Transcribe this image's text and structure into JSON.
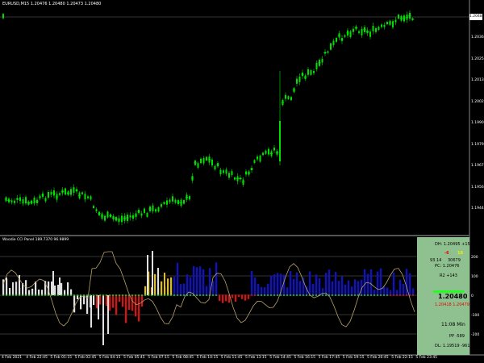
{
  "header": {
    "symbol_line": "EURUSD,M15  1.20476 1.20480 1.20473 1.20480"
  },
  "price_axis": {
    "current_price": "1.20480",
    "ticks": [
      "1.20480",
      "1.20365",
      "1.20250",
      "1.20135",
      "1.20020",
      "1.19905",
      "1.19790",
      "1.19675",
      "1.19560",
      "1.19445"
    ]
  },
  "time_axis": {
    "ticks": [
      "4 Feb 2021",
      "4 Feb 22:45",
      "5 Feb 01:15",
      "5 Feb 02:45",
      "5 Feb 04:15",
      "5 Feb 05:45",
      "5 Feb 07:15",
      "5 Feb 08:45",
      "5 Feb 10:15",
      "5 Feb 11:45",
      "5 Feb 13:15",
      "5 Feb 14:45",
      "5 Feb 16:15",
      "5 Feb 17:45",
      "5 Feb 19:15",
      "5 Feb 20:45",
      "5 Feb 22:15",
      "5 Feb 23:45"
    ]
  },
  "indicator": {
    "title": "Woodie CCI Panel 189.7370 96.9899",
    "levels": [
      "200",
      "100",
      "0",
      "-100",
      "-200"
    ]
  },
  "panel": {
    "dh": "DH: 1.20495  +15",
    "dn_val": "-6",
    "up_val": "18",
    "rsi": "93.14",
    "rsi2": "30679",
    "pc": "PC: 1.20476",
    "r2": "R2 +143",
    "price": "1.20480",
    "sub_price": "1.20418  1.20479",
    "time": "11:08 Min",
    "pp": "PP -589",
    "dl": "DL: 1.19519 -961"
  },
  "colors": {
    "candle": "#00e000",
    "hist_blue": "#1010d0",
    "hist_red": "#e01010",
    "hist_yellow": "#e0c000",
    "hist_white": "#e0e0e0",
    "line_tan": "#b9a26a"
  }
}
